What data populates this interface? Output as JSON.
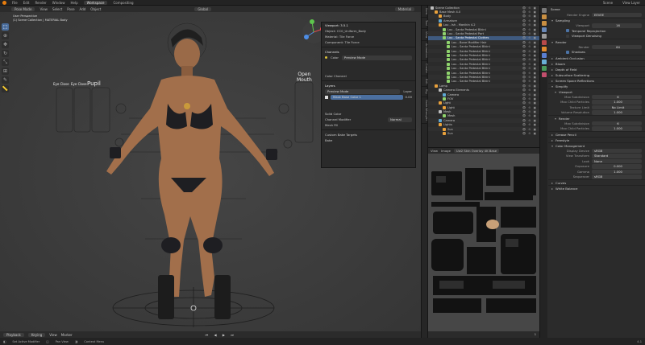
{
  "topbar": {
    "menus": [
      "File",
      "Edit",
      "Render",
      "Window",
      "Help"
    ],
    "workspace_active": "Workspace",
    "workspace_next": "Compositing",
    "scene": "Scene",
    "view_layer": "View Layer"
  },
  "viewport": {
    "header": {
      "mode": "Pose Mode",
      "items": [
        "View",
        "Select",
        "Pose",
        "Add",
        "Object"
      ],
      "transform": "Global",
      "shading": "Material"
    },
    "info_line1": "User Perspective",
    "info_line2": "(1) Scene Collection | MATERIAL Body",
    "labels": {
      "eye_a": "Eye Close",
      "eye_b": "Eye Close",
      "pupil": "Pupil",
      "open_mouth_1": "Open",
      "open_mouth_2": "Mouth"
    },
    "footer": {
      "playback": "Playback",
      "keying": "Keying",
      "view": "View",
      "marker": "Marker"
    }
  },
  "npanel": {
    "rows": {
      "viewport_section": "Viewport: 3.5.1",
      "object": "Object: CC0_Uniform_Body",
      "material": "Material: Tile Force",
      "component": "Component: Tile Force",
      "channels": "Channels",
      "color": "Color",
      "color_node": "Preview Mode",
      "color_channel": "Color Channel",
      "layers": "Layers",
      "blend_mode": "Preview Mode",
      "layer_col": "Layer",
      "mask_layer": "Mask Base Color 1",
      "mask_value": "0.00",
      "solid_color": "Solid Color",
      "channel_modifier": "Channel Modifier",
      "normal": "Normal",
      "mesh_fill": "Mesh Fill",
      "custom_bake": "Custom Bake Targets",
      "bake": "Bake"
    }
  },
  "vtabs": [
    "Item",
    "Tool",
    "View",
    "Animation",
    "Create",
    "Edit",
    "Rig",
    "Node Wrangler"
  ],
  "outliner": {
    "rows": [
      {
        "label": "Scene Collection",
        "indent": 0,
        "sel": false,
        "color": "#bfbfbf"
      },
      {
        "label": "Base Mesh 4.0",
        "indent": 1,
        "sel": false,
        "color": "#e9a13b"
      },
      {
        "label": "Body",
        "indent": 2,
        "sel": false,
        "color": "#e9a13b"
      },
      {
        "label": "Armature",
        "indent": 2,
        "sel": false,
        "color": "#5fa8d3"
      },
      {
        "label": "Lou - Ish - Manikin 4.2",
        "indent": 2,
        "sel": false,
        "color": "#e9a13b"
      },
      {
        "label": "Lou - Santa Pedestal Bikini",
        "indent": 3,
        "sel": false,
        "color": "#8fd36d"
      },
      {
        "label": "Lou - Santa Pedestal Part",
        "indent": 3,
        "sel": false,
        "color": "#8fd36d"
      },
      {
        "label": "Lou - Santa Pedestal Clothes",
        "indent": 3,
        "sel": true,
        "color": "#8fd36d"
      },
      {
        "label": "Lou - Bone Modifier Hair",
        "indent": 4,
        "sel": false,
        "color": "#8fd36d"
      },
      {
        "label": "Lou - Santa Pedestal Bikini",
        "indent": 4,
        "sel": false,
        "color": "#8fd36d"
      },
      {
        "label": "Lou - Santa Pedestal Bikini",
        "indent": 4,
        "sel": false,
        "color": "#8fd36d"
      },
      {
        "label": "Lou - Santa Pedestal Bikini",
        "indent": 4,
        "sel": false,
        "color": "#8fd36d"
      },
      {
        "label": "Lou - Santa Pedestal Bikini",
        "indent": 4,
        "sel": false,
        "color": "#8fd36d"
      },
      {
        "label": "Lou - Santa Pedestal Bikini",
        "indent": 4,
        "sel": false,
        "color": "#8fd36d"
      },
      {
        "label": "Lou - Santa Pedestal Bikini",
        "indent": 4,
        "sel": false,
        "color": "#8fd36d"
      },
      {
        "label": "Lou - Santa Pedestal Bikini",
        "indent": 4,
        "sel": false,
        "color": "#8fd36d"
      },
      {
        "label": "Lou - Santa Pedestal Bikini",
        "indent": 4,
        "sel": false,
        "color": "#8fd36d"
      },
      {
        "label": "Lou - Santa Pedestal Bikini",
        "indent": 4,
        "sel": false,
        "color": "#8fd36d"
      },
      {
        "label": "Lamp",
        "indent": 1,
        "sel": false,
        "color": "#e9a13b"
      },
      {
        "label": "Camera Elements",
        "indent": 2,
        "sel": false,
        "color": "#bfbfbf"
      },
      {
        "label": "Camera",
        "indent": 3,
        "sel": false,
        "color": "#5fa8d3"
      },
      {
        "label": "FOV",
        "indent": 3,
        "sel": false,
        "color": "#8fd36d"
      },
      {
        "label": "Light",
        "indent": 2,
        "sel": false,
        "color": "#e9a13b"
      },
      {
        "label": "Light",
        "indent": 3,
        "sel": false,
        "color": "#e9a13b"
      },
      {
        "label": "Mesh",
        "indent": 2,
        "sel": false,
        "color": "#bfbfbf"
      },
      {
        "label": "Mesh",
        "indent": 3,
        "sel": false,
        "color": "#8fd36d"
      },
      {
        "label": "Camera",
        "indent": 2,
        "sel": false,
        "color": "#5fa8d3"
      },
      {
        "label": "Lights",
        "indent": 2,
        "sel": false,
        "color": "#e9a13b"
      },
      {
        "label": "Sun",
        "indent": 3,
        "sel": false,
        "color": "#e9a13b"
      },
      {
        "label": "Sun",
        "indent": 3,
        "sel": false,
        "color": "#e9a13b"
      }
    ],
    "vis": "👁 ⊙ ▣"
  },
  "uveditor": {
    "header": {
      "view": "View",
      "image": "Image",
      "image_name": "Uw2 Skin Overlay 4K Base"
    },
    "frame": "1"
  },
  "props": {
    "title": "Scene",
    "render_engine_label": "Render Engine",
    "render_engine": "EEVEE",
    "sections": {
      "sampling": "Sampling",
      "viewport": "Viewport",
      "render": "Render",
      "ambient_occlusion": "Ambient Occlusion",
      "bloom": "Bloom",
      "depth_of_field": "Depth of Field",
      "subsurface": "Subsurface Scattering",
      "screen_space": "Screen Space Reflections",
      "motion_blur": "Motion Blur",
      "volumetrics": "Volumetrics",
      "performance": "Performance",
      "curves": "Curves",
      "shadows": "Shadows",
      "indirect": "Indirect Lighting",
      "film": "Film",
      "simplify": "Simplify",
      "grease_pencil": "Grease Pencil",
      "freestyle": "Freestyle",
      "color_management": "Color Management",
      "curves2": "Curves",
      "white_balance": "White Balance"
    },
    "sampling": {
      "viewport": "Viewport",
      "viewport_val": "16",
      "render": "Render",
      "render_val": "64"
    },
    "denoise": "Temporal Reprojection",
    "denoise2": "Viewport Denoising",
    "simplify": {
      "max_subdiv": "Max Subdivision",
      "max_subdiv_val": "6",
      "max_child": "Max Child Particles",
      "max_child_val": "1.000",
      "texture_limit": "Texture Limit",
      "texture_limit_val": "No Limit",
      "volume_res": "Volume Resolution",
      "volume_res_val": "1.000"
    },
    "render_sub": {
      "max_subdiv": "Max Subdivision",
      "max_subdiv_val": "6",
      "max_child": "Max Child Particles",
      "max_child_val": "1.000"
    },
    "color": {
      "display_device": "Display Device",
      "display_device_val": "sRGB",
      "view_transform": "View Transform",
      "view_transform_val": "Standard",
      "look": "Look",
      "look_val": "None",
      "exposure": "Exposure",
      "exposure_val": "0.000",
      "gamma": "Gamma",
      "gamma_val": "1.000",
      "sequencer": "Sequencer",
      "sequencer_val": "sRGB"
    },
    "use_curves": "Use Curves"
  },
  "status": {
    "left": "Set Active Modifier",
    "mid": "Pan View",
    "mid2": "Context Menu",
    "right": "4.1"
  },
  "colors": {
    "accent": "#4b6f9f",
    "orange": "#e87d0d"
  }
}
